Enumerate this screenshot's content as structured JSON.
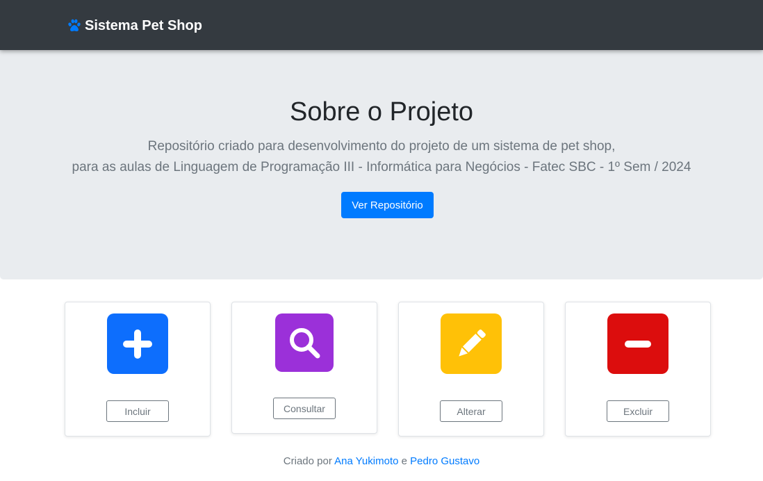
{
  "navbar": {
    "brand_label": "Sistema Pet Shop",
    "brand_icon": "paw-icon",
    "colors": {
      "background": "#343a40",
      "icon": "#007bff"
    }
  },
  "hero": {
    "title": "Sobre o Projeto",
    "lead_line1": "Repositório criado para desenvolvimento do projeto de um sistema de pet shop,",
    "lead_line2": "para as aulas de Linguagem de Programação III - Informática para Negócios - Fatec SBC - 1º Sem / 2024",
    "button_label": "Ver Repositório"
  },
  "actions": [
    {
      "label": "Incluir",
      "icon": "plus-icon",
      "color": "#0d6efd"
    },
    {
      "label": "Consultar",
      "icon": "search-icon",
      "color": "#9b30d9"
    },
    {
      "label": "Alterar",
      "icon": "pencil-icon",
      "color": "#ffc107"
    },
    {
      "label": "Excluir",
      "icon": "minus-icon",
      "color": "#dc0d0d"
    }
  ],
  "footer": {
    "prefix": "Criado por",
    "author1": "Ana Yukimoto",
    "conjunction": "e",
    "author2": "Pedro Gustavo"
  }
}
